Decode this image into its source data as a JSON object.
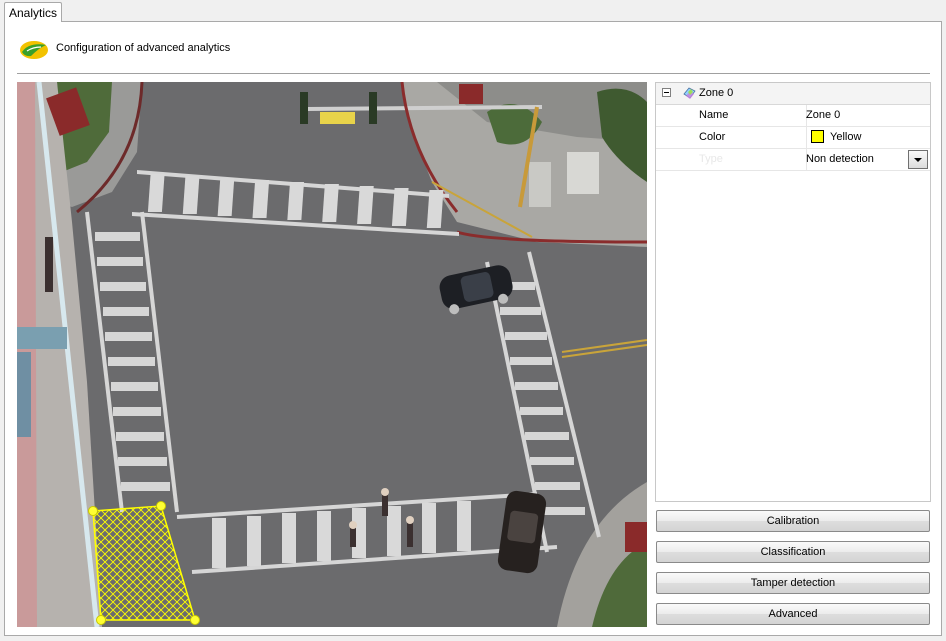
{
  "tab": {
    "label": "Analytics"
  },
  "header": {
    "title": "Configuration of advanced analytics",
    "logo_icon": "analytics-logo-icon"
  },
  "properties": {
    "group_label": "Zone 0",
    "rows": [
      {
        "key": "Name",
        "value": "Zone 0"
      },
      {
        "key": "Color",
        "value": "Yellow",
        "swatch": "#ffff00"
      },
      {
        "key": "Type",
        "value": "Non detection"
      }
    ]
  },
  "buttons": {
    "calibration": "Calibration",
    "classification": "Classification",
    "tamper": "Tamper detection",
    "advanced": "Advanced"
  },
  "video": {
    "zone_color": "#ffff00"
  }
}
